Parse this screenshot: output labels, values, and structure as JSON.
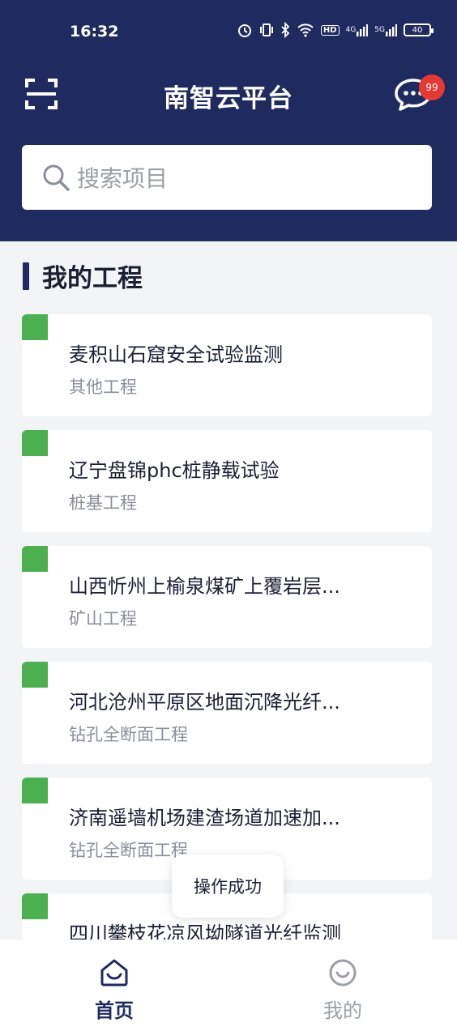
{
  "status_bar": {
    "time": "16:32",
    "signal_label_1": "4G",
    "signal_label_2": "5G",
    "hd_label": "HD",
    "battery": "40"
  },
  "header": {
    "title": "南智云平台",
    "badge_count": "99"
  },
  "search": {
    "placeholder": "搜索项目"
  },
  "section": {
    "title": "我的工程"
  },
  "projects": [
    {
      "name": "麦积山石窟安全试验监测",
      "type": "其他工程"
    },
    {
      "name": "辽宁盘锦phc桩静载试验",
      "type": "桩基工程"
    },
    {
      "name": "山西忻州上榆泉煤矿上覆岩层...",
      "type": "矿山工程"
    },
    {
      "name": "河北沧州平原区地面沉降光纤...",
      "type": "钻孔全断面工程"
    },
    {
      "name": "济南遥墙机场建渣场道加速加...",
      "type": "钻孔全断面工程"
    },
    {
      "name": "四川攀枝花凉风坳隧道光纤监测",
      "type": ""
    }
  ],
  "toast": {
    "text": "操作成功"
  },
  "nav": {
    "home": "首页",
    "mine": "我的"
  },
  "colors": {
    "header_bg": "#1f2a5f",
    "marker": "#4caf50",
    "badge": "#e53935"
  }
}
